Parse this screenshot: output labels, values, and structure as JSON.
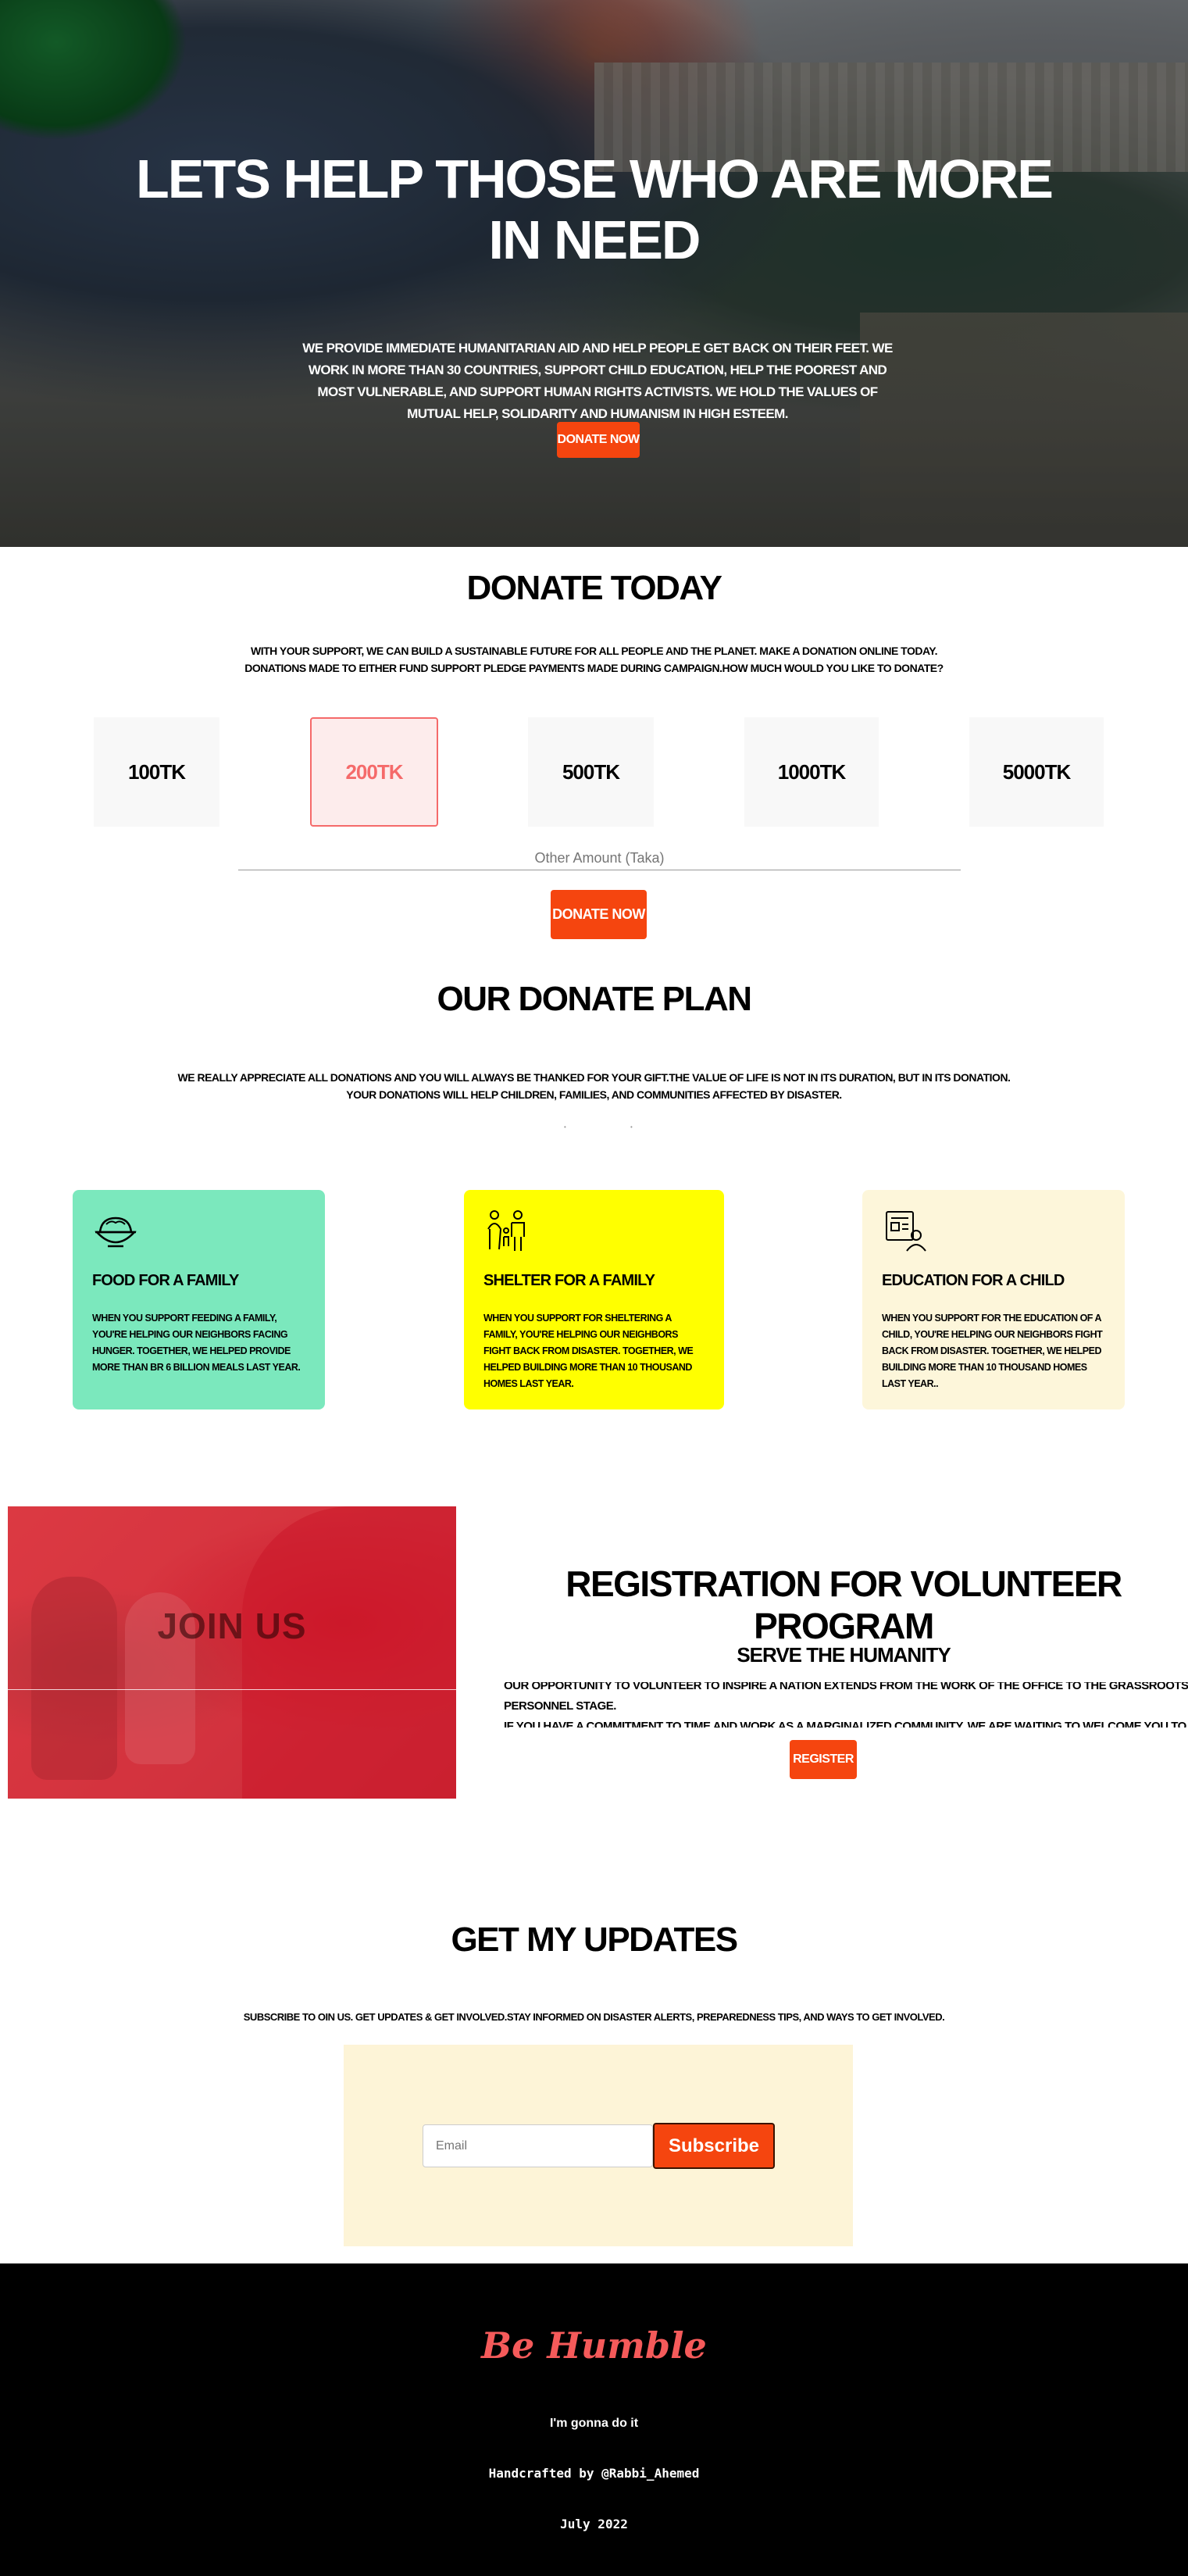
{
  "hero": {
    "title_line1": "LETS HELP THOSE WHO ARE MORE",
    "title_line2": "IN NEED",
    "description": "We provide immediate humanitarian aid and help people get back on their feet. We work in more than 30 countries, support child education, help the poorest and most vulnerable, and support human rights activists. We hold the values of mutual help, solidarity and humanism in high esteem.",
    "button_label": "Donate Now"
  },
  "donate": {
    "title": "Donate Today",
    "description_line1": "With your support, we can build a sustainable future for all people and the planet. Make a donation online today.",
    "description_line2": "Donations made to either fund support pledge payments made during campaign.How much would you like to donate?",
    "amounts": [
      {
        "label": "100TK"
      },
      {
        "label": "200TK"
      },
      {
        "label": "500TK"
      },
      {
        "label": "1000TK"
      },
      {
        "label": "5000TK"
      }
    ],
    "selected_amount": "200TK",
    "other_amount_placeholder": "Other Amount (Taka)",
    "button_label": "Donate Now"
  },
  "plan": {
    "title": "Our Donate Plan",
    "description_line1": "We really appreciate all donations and you will always be thanked for your gift.The value of life is not in its duration, but in its donation.",
    "description_line2": "Your donations will help children, families, and communities affected by disaster.",
    "cards": [
      {
        "title": "Food for a family",
        "text": "When you support feeding a family, you're helping our neighbors facing hunger. Together, we helped provide more than BR 6 billion meals last year.",
        "icon": "food-bowl-icon",
        "color": "#7be8bd"
      },
      {
        "title": "Shelter for a family",
        "text": "When you support for sheltering a family, you're helping our neighbors fight back from disaster. Together, we helped building more than 10 thousand homes last year.",
        "icon": "family-icon",
        "color": "#ffff00"
      },
      {
        "title": "Education for a child",
        "text": "When you support for the education of a child, you're helping our neighbors fight back from disaster. Together, we helped building more than 10 thousand homes last year..",
        "icon": "education-icon",
        "color": "#fdf6da"
      }
    ]
  },
  "volunteer": {
    "image_caption": "JOIN US",
    "title": "Registration for volunteer program",
    "subtitle": "Serve the Humanity",
    "description_line1": "Our opportunity to volunteer to inspire a nation extends from the work of the office to the grassroots personnel stage.",
    "description_line2": "If you have a commitment to time and work as a marginalized community, we are waiting to welcome you to our team.",
    "button_label": "Register"
  },
  "updates": {
    "title": "Get My Updates",
    "description": "Subscribe to oin us. Get updates & get involved.Stay informed on disaster alerts, preparedness tips, and ways to get involved.",
    "email_placeholder": "Email",
    "button_label": "Subscribe"
  },
  "footer": {
    "brand": "Be Humble",
    "tagline": "I'm gonna do it",
    "credit": "Handcrafted by @Rabbi_Ahemed",
    "date": "July 2022"
  },
  "colors": {
    "accent": "#f5450f",
    "selected_border": "#f56a6a",
    "brand": "#f55a5a",
    "footer_bg": "#000000",
    "subscribe_bg": "#fdf4d7"
  }
}
